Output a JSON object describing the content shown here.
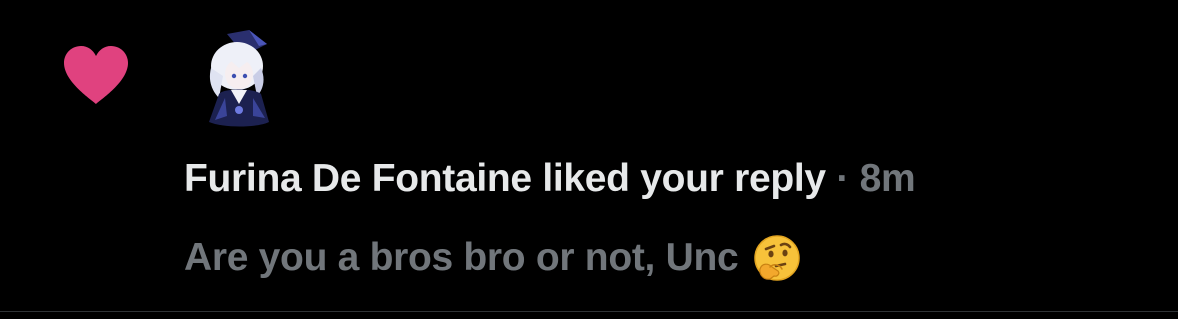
{
  "notification": {
    "user_name": "Furina De Fontaine",
    "action": " liked your reply",
    "separator": " · ",
    "time": "8m",
    "reply_text": "Are you a bros bro or not, Unc",
    "emoji": "thinking-face",
    "icon": "heart-icon",
    "icon_color": "#e0427f"
  },
  "colors": {
    "background": "#000000",
    "primary_text": "#e7e9ea",
    "secondary_text": "#71767b",
    "divider": "#2f3336"
  }
}
